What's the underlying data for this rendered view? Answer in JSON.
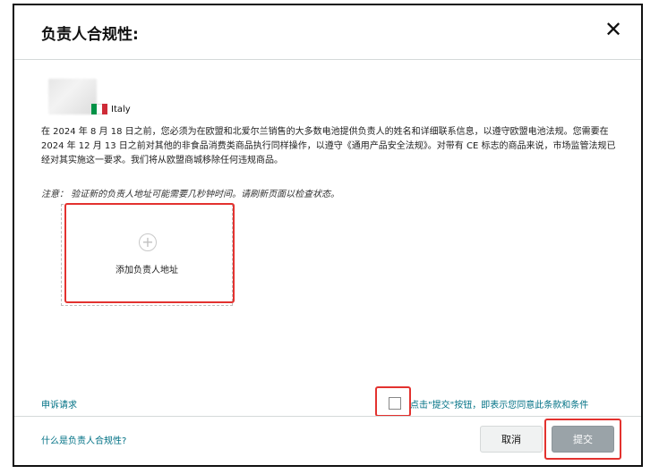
{
  "dialog": {
    "title": "负责人合规性:",
    "close_symbol": "✕"
  },
  "country": {
    "name": "Italy",
    "flag_colors": [
      "#009246",
      "#ffffff",
      "#ce2b37"
    ]
  },
  "description": "在 2024 年 8 月 18 日之前，您必须为在欧盟和北爱尔兰销售的大多数电池提供负责人的姓名和详细联系信息，以遵守欧盟电池法规。您需要在 2024 年 12 月 13 日之前对其他的非食品消费类商品执行同样操作，以遵守《通用产品安全法规》。对带有 CE 标志的商品来说，市场监管法规已经对其实施这一要求。我们将从欧盟商城移除任何违规商品。",
  "note": "注意： 验证新的负责人地址可能需要几秒钟时间。请刷新页面以检查状态。",
  "add_address": {
    "plus_symbol": "+",
    "label": "添加负责人地址"
  },
  "appeal_link": "申诉请求",
  "agreement": {
    "checked": false,
    "text": "点击\"提交\"按钮，即表示您同意此条款和条件"
  },
  "footer": {
    "help_link": "什么是负责人合规性?",
    "cancel_label": "取消",
    "submit_label": "提交"
  },
  "colors": {
    "link": "#007185",
    "highlight": "#e3322f",
    "submit_disabled": "#9aa3a8"
  }
}
